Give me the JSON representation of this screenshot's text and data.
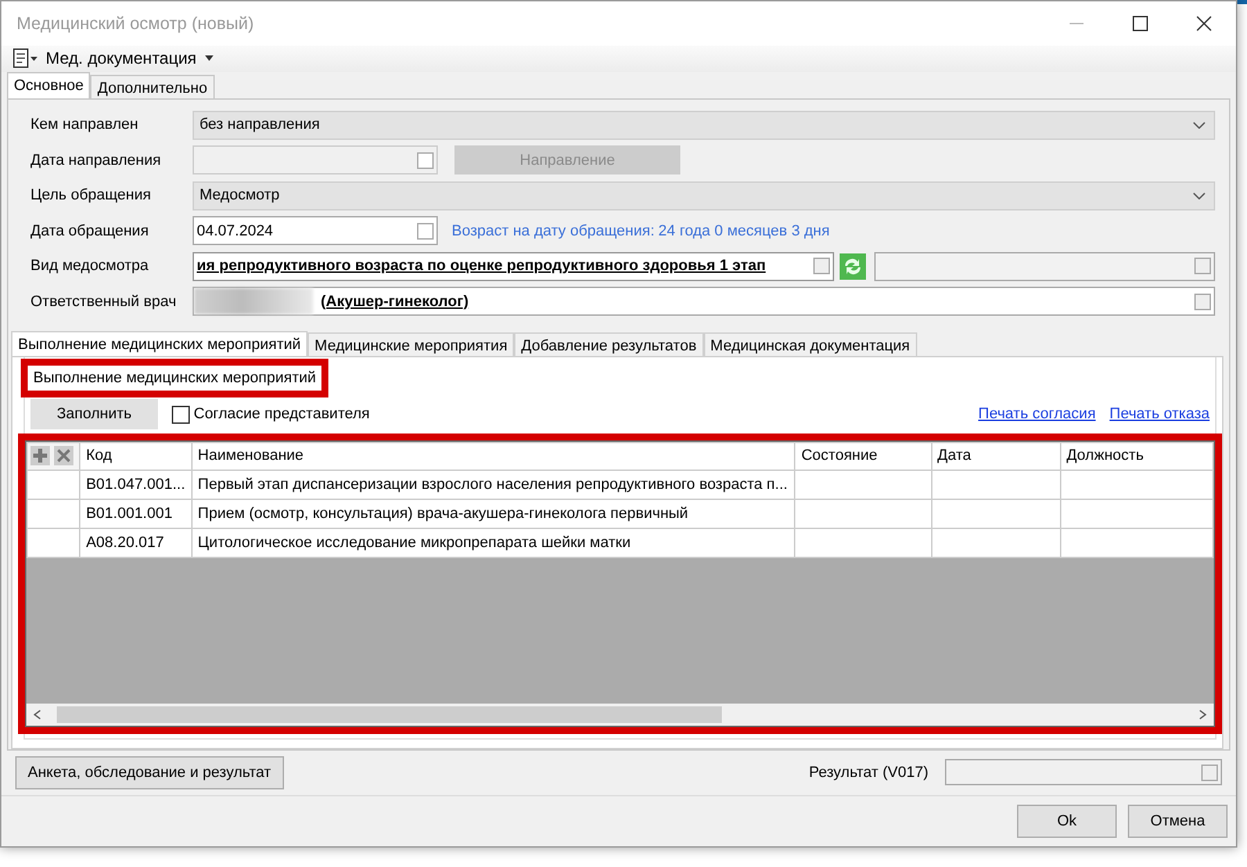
{
  "window": {
    "title": "Медицинский осмотр (новый)"
  },
  "toolbar": {
    "menu": "Мед. документация"
  },
  "tabs": [
    {
      "label": "Основное",
      "selected": true
    },
    {
      "label": "Дополнительно",
      "selected": false
    }
  ],
  "form": [
    {
      "kind": "combo",
      "label": "Кем направлен",
      "value": "без направления"
    },
    {
      "kind": "date",
      "label": "Дата направления",
      "disabled": true,
      "button": "Направление"
    },
    {
      "kind": "combo",
      "label": "Цель обращения",
      "value": "Медосмотр"
    },
    {
      "kind": "date",
      "label": "Дата обращения",
      "value": "04.07.2024",
      "disabled": false,
      "info_label": "Возраст на дату обращения:",
      "info_value": "24 года 0 месяцев 3 дня"
    },
    {
      "kind": "lookup",
      "label": "Вид медосмотра",
      "value": "ия репродуктивного возраста по оценке репродуктивного здоровья 1 этап"
    },
    {
      "kind": "person",
      "label": "Ответственный врач",
      "value": "(Акушер-гинеколог)"
    }
  ],
  "subtabs": [
    {
      "label": "Выполнение медицинских мероприятий",
      "selected": true
    },
    {
      "label": "Медицинские мероприятия",
      "selected": false
    },
    {
      "label": "Добавление результатов",
      "selected": false
    },
    {
      "label": "Медицинская документация",
      "selected": false
    }
  ],
  "group": {
    "title": "Выполнение медицинских мероприятий",
    "highlighted": true
  },
  "fill_button": "Заполнить",
  "consent": {
    "label": "Согласие представителя",
    "checked": false
  },
  "links": [
    "Печать согласия",
    "Печать отказа"
  ],
  "table": {
    "highlighted": true,
    "columns": [
      "Код",
      "Наименование",
      "Состояние",
      "Дата",
      "Должность"
    ],
    "rows": [
      [
        "B01.047.001...",
        "Первый этап диспансеризации взрослого населения репродуктивного возраста п..."
      ],
      [
        "B01.001.001",
        "Прием (осмотр, консультация) врача-акушера-гинеколога первичный"
      ],
      [
        "A08.20.017",
        "Цитологическое исследование микропрепарата шейки матки"
      ]
    ]
  },
  "footer": {
    "button": "Анкета, обследование и результат",
    "result_label": "Результат (V017)"
  },
  "buttons": [
    "Ok",
    "Отмена"
  ]
}
